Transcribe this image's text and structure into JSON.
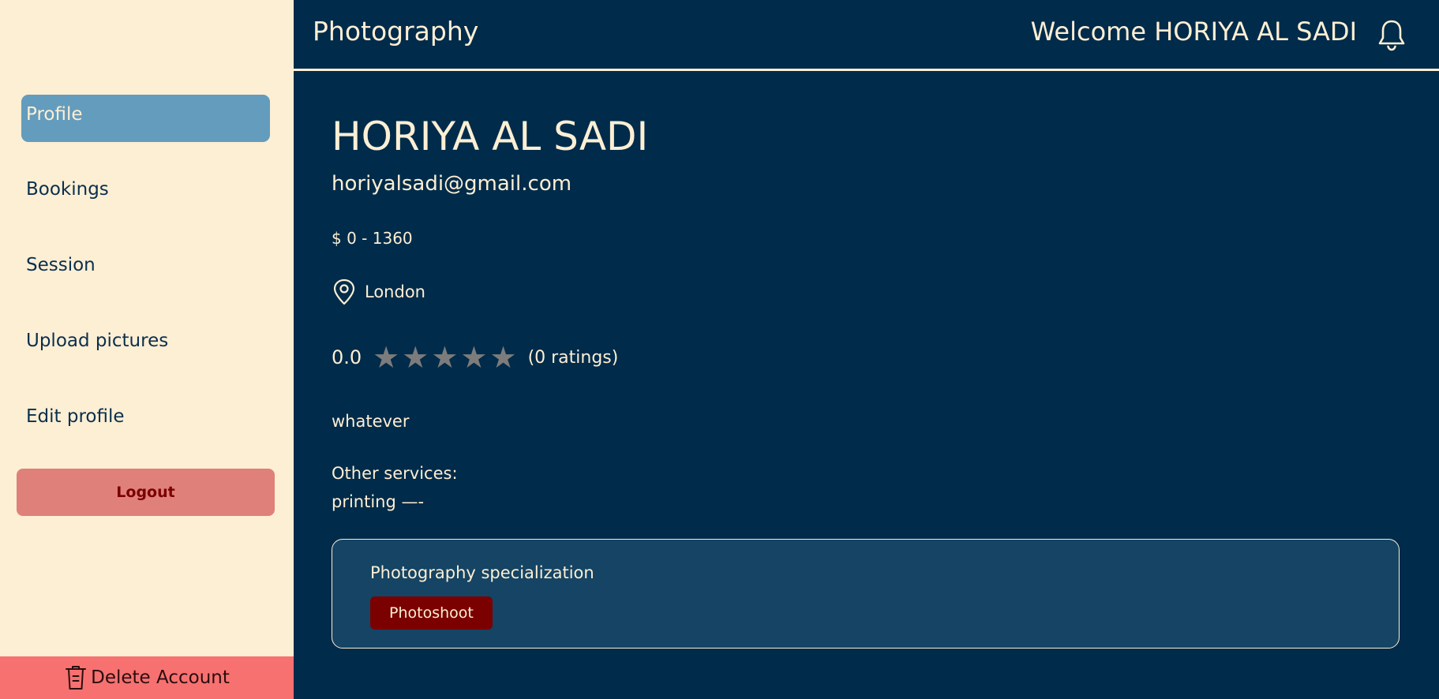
{
  "colors": {
    "sidebar_bg": "#fdefd4",
    "main_bg": "#002b4a",
    "active_nav": "#649cbd",
    "logout_bg": "#e0807b",
    "delete_bg": "#f77171",
    "card_bg": "#154464",
    "tag_bg": "#7b0000",
    "star_empty": "#7c7c7c"
  },
  "sidebar": {
    "items": [
      {
        "label": "Profile",
        "active": true
      },
      {
        "label": "Bookings",
        "active": false
      },
      {
        "label": "Session",
        "active": false
      },
      {
        "label": "Upload pictures",
        "active": false
      },
      {
        "label": "Edit profile",
        "active": false
      }
    ],
    "logout_label": "Logout",
    "delete_label": "Delete Account",
    "delete_icon": "trash-icon"
  },
  "header": {
    "brand": "Photography",
    "welcome": "Welcome HORIYA AL SADI",
    "bell_icon": "bell-icon"
  },
  "profile": {
    "name": "HORIYA AL SADI",
    "email": "horiyalsadi@gmail.com",
    "price_range": "$ 0 - 1360",
    "location": "London",
    "location_icon": "map-pin-icon",
    "rating_value": "0.0",
    "stars_filled": 0,
    "stars_total": 5,
    "rating_count": "(0 ratings)",
    "description": "whatever",
    "other_services_label": "Other services:",
    "other_services_value": "printing —-",
    "specialization": {
      "title": "Photography specialization",
      "tags": [
        "Photoshoot"
      ]
    }
  }
}
